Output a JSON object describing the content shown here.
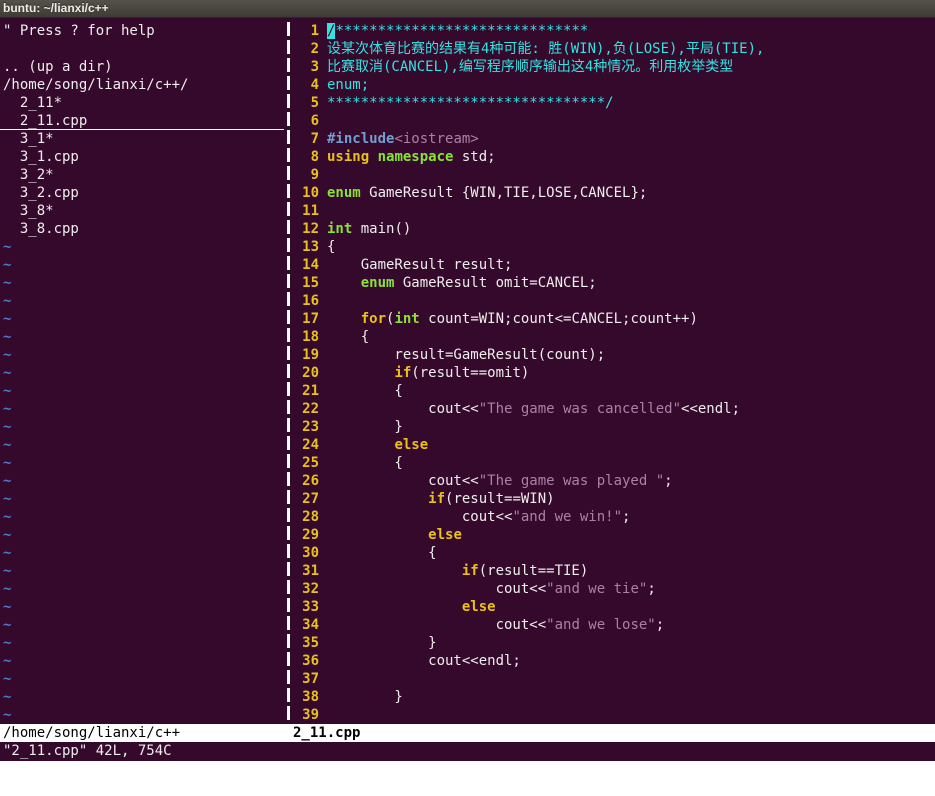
{
  "window": {
    "title": "buntu: ~/lianxi/c++"
  },
  "colors": {
    "terminal_bg": "#35092b",
    "foreground": "#eeeeec",
    "comment_cyan": "#34e2e2",
    "keyword_yellow": "#e9c11a",
    "type_green": "#8ae234",
    "preproc_blue": "#729fcf",
    "string_purple": "#ad7fa8",
    "tilde_blue": "#4e79c7",
    "statusline_bg": "#ffffff",
    "statusline_fg": "#000000",
    "titlebar_bg": "#44413c"
  },
  "file_tree": {
    "rows": [
      {
        "text": "\" Press ? for help"
      },
      {
        "text": ""
      },
      {
        "text": ".. (up a dir)"
      },
      {
        "text": "/home/song/lianxi/c++/"
      },
      {
        "text": "  2_11*"
      },
      {
        "text": "  2_11.cpp",
        "selected": true
      },
      {
        "text": "  3_1*"
      },
      {
        "text": "  3_1.cpp"
      },
      {
        "text": "  3_2*"
      },
      {
        "text": "  3_2.cpp"
      },
      {
        "text": "  3_8*"
      },
      {
        "text": "  3_8.cpp"
      }
    ],
    "tilde": "~",
    "tilde_count": 27
  },
  "editor": {
    "lines": [
      {
        "n": 1,
        "segs": [
          {
            "c": "c",
            "t": "/",
            "cur": true
          },
          {
            "c": "c",
            "t": "******************************"
          }
        ]
      },
      {
        "n": 2,
        "segs": [
          {
            "c": "c",
            "t": "设某次体育比赛的结果有4种可能: 胜(WIN),负(LOSE),平局(TIE),"
          }
        ]
      },
      {
        "n": 3,
        "segs": [
          {
            "c": "c",
            "t": "比赛取消(CANCEL),编写程序顺序输出这4种情况。利用枚举类型"
          }
        ]
      },
      {
        "n": 4,
        "segs": [
          {
            "c": "c",
            "t": "enum;"
          }
        ]
      },
      {
        "n": 5,
        "segs": [
          {
            "c": "c",
            "t": "*********************************/"
          }
        ]
      },
      {
        "n": 6,
        "segs": []
      },
      {
        "n": 7,
        "segs": [
          {
            "c": "p",
            "t": "#include"
          },
          {
            "c": "s",
            "t": "<iostream>"
          }
        ]
      },
      {
        "n": 8,
        "segs": [
          {
            "c": "k",
            "t": "using"
          },
          {
            "c": "n",
            "t": " "
          },
          {
            "c": "t",
            "t": "namespace"
          },
          {
            "c": "n",
            "t": " std;"
          }
        ]
      },
      {
        "n": 9,
        "segs": []
      },
      {
        "n": 10,
        "segs": [
          {
            "c": "t",
            "t": "enum"
          },
          {
            "c": "n",
            "t": " GameResult {WIN,TIE,LOSE,CANCEL};"
          }
        ]
      },
      {
        "n": 11,
        "segs": []
      },
      {
        "n": 12,
        "segs": [
          {
            "c": "t",
            "t": "int"
          },
          {
            "c": "n",
            "t": " main()"
          }
        ]
      },
      {
        "n": 13,
        "segs": [
          {
            "c": "n",
            "t": "{"
          }
        ]
      },
      {
        "n": 14,
        "segs": [
          {
            "c": "n",
            "t": "    GameResult result;"
          }
        ]
      },
      {
        "n": 15,
        "segs": [
          {
            "c": "n",
            "t": "    "
          },
          {
            "c": "t",
            "t": "enum"
          },
          {
            "c": "n",
            "t": " GameResult omit=CANCEL;"
          }
        ]
      },
      {
        "n": 16,
        "segs": []
      },
      {
        "n": 17,
        "segs": [
          {
            "c": "n",
            "t": "    "
          },
          {
            "c": "k",
            "t": "for"
          },
          {
            "c": "n",
            "t": "("
          },
          {
            "c": "t",
            "t": "int"
          },
          {
            "c": "n",
            "t": " count=WIN;count<=CANCEL;count++)"
          }
        ]
      },
      {
        "n": 18,
        "segs": [
          {
            "c": "n",
            "t": "    {"
          }
        ]
      },
      {
        "n": 19,
        "segs": [
          {
            "c": "n",
            "t": "        result=GameResult(count);"
          }
        ]
      },
      {
        "n": 20,
        "segs": [
          {
            "c": "n",
            "t": "        "
          },
          {
            "c": "k",
            "t": "if"
          },
          {
            "c": "n",
            "t": "(result==omit)"
          }
        ]
      },
      {
        "n": 21,
        "segs": [
          {
            "c": "n",
            "t": "        {"
          }
        ]
      },
      {
        "n": 22,
        "segs": [
          {
            "c": "n",
            "t": "            cout<<"
          },
          {
            "c": "s",
            "t": "\"The game was cancelled\""
          },
          {
            "c": "n",
            "t": "<<endl;"
          }
        ]
      },
      {
        "n": 23,
        "segs": [
          {
            "c": "n",
            "t": "        }"
          }
        ]
      },
      {
        "n": 24,
        "segs": [
          {
            "c": "n",
            "t": "        "
          },
          {
            "c": "k",
            "t": "else"
          }
        ]
      },
      {
        "n": 25,
        "segs": [
          {
            "c": "n",
            "t": "        {"
          }
        ]
      },
      {
        "n": 26,
        "segs": [
          {
            "c": "n",
            "t": "            cout<<"
          },
          {
            "c": "s",
            "t": "\"The game was played \""
          },
          {
            "c": "n",
            "t": ";"
          }
        ]
      },
      {
        "n": 27,
        "segs": [
          {
            "c": "n",
            "t": "            "
          },
          {
            "c": "k",
            "t": "if"
          },
          {
            "c": "n",
            "t": "(result==WIN)"
          }
        ]
      },
      {
        "n": 28,
        "segs": [
          {
            "c": "n",
            "t": "                cout<<"
          },
          {
            "c": "s",
            "t": "\"and we win!\""
          },
          {
            "c": "n",
            "t": ";"
          }
        ]
      },
      {
        "n": 29,
        "segs": [
          {
            "c": "n",
            "t": "            "
          },
          {
            "c": "k",
            "t": "else"
          }
        ]
      },
      {
        "n": 30,
        "segs": [
          {
            "c": "n",
            "t": "            {"
          }
        ]
      },
      {
        "n": 31,
        "segs": [
          {
            "c": "n",
            "t": "                "
          },
          {
            "c": "k",
            "t": "if"
          },
          {
            "c": "n",
            "t": "(result==TIE)"
          }
        ]
      },
      {
        "n": 32,
        "segs": [
          {
            "c": "n",
            "t": "                    cout<<"
          },
          {
            "c": "s",
            "t": "\"and we tie\""
          },
          {
            "c": "n",
            "t": ";"
          }
        ]
      },
      {
        "n": 33,
        "segs": [
          {
            "c": "n",
            "t": "                "
          },
          {
            "c": "k",
            "t": "else"
          }
        ]
      },
      {
        "n": 34,
        "segs": [
          {
            "c": "n",
            "t": "                    cout<<"
          },
          {
            "c": "s",
            "t": "\"and we lose\""
          },
          {
            "c": "n",
            "t": ";"
          }
        ]
      },
      {
        "n": 35,
        "segs": [
          {
            "c": "n",
            "t": "            }"
          }
        ]
      },
      {
        "n": 36,
        "segs": [
          {
            "c": "n",
            "t": "            cout<<endl;"
          }
        ]
      },
      {
        "n": 37,
        "segs": []
      },
      {
        "n": 38,
        "segs": [
          {
            "c": "n",
            "t": "        }"
          }
        ]
      },
      {
        "n": 39,
        "segs": []
      }
    ]
  },
  "statusline": {
    "left": "/home/song/lianxi/c++",
    "right": "2_11.cpp"
  },
  "cmdline": "\"2_11.cpp\" 42L, 754C"
}
